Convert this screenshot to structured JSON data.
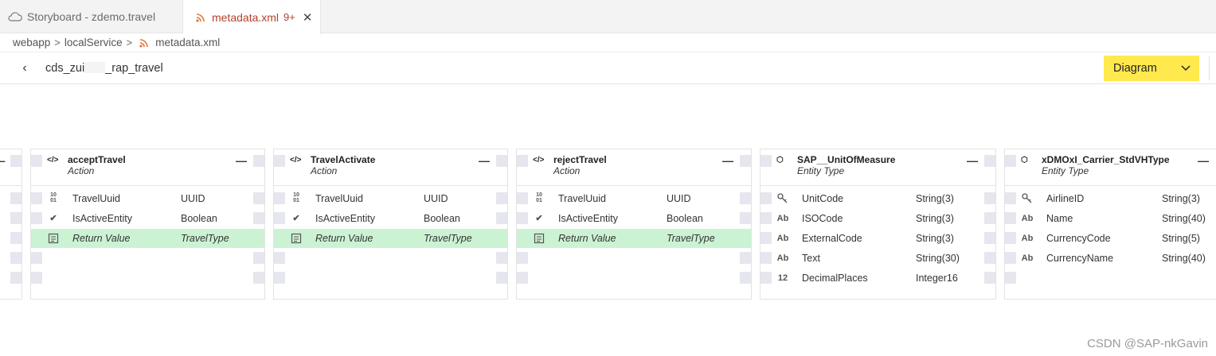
{
  "tabs": [
    {
      "label": "Storyboard - zdemo.travel",
      "icon": "cloud-icon"
    },
    {
      "label": "metadata.xml",
      "badge": "9+",
      "icon": "rss-icon",
      "close": "✕"
    }
  ],
  "breadcrumb": [
    "webapp",
    "localService",
    "metadata.xml"
  ],
  "header": {
    "back": "‹",
    "title_prefix": "cds_zui",
    "title_suffix": "_rap_travel",
    "view_selected": "Diagram"
  },
  "cards": [
    {
      "name": "acceptTravel",
      "type": "Action",
      "icon": "</>",
      "rows": [
        {
          "icon": "10 01",
          "name": "TravelUuid",
          "type": "UUID"
        },
        {
          "icon": "✔",
          "name": "IsActiveEntity",
          "type": "Boolean"
        },
        {
          "icon": "▤",
          "name": "Return Value",
          "type": "TravelType",
          "ret": true
        }
      ]
    },
    {
      "name": "TravelActivate",
      "type": "Action",
      "icon": "</>",
      "rows": [
        {
          "icon": "10 01",
          "name": "TravelUuid",
          "type": "UUID"
        },
        {
          "icon": "✔",
          "name": "IsActiveEntity",
          "type": "Boolean"
        },
        {
          "icon": "▤",
          "name": "Return Value",
          "type": "TravelType",
          "ret": true
        }
      ]
    },
    {
      "name": "rejectTravel",
      "type": "Action",
      "icon": "</>",
      "rows": [
        {
          "icon": "10 01",
          "name": "TravelUuid",
          "type": "UUID"
        },
        {
          "icon": "✔",
          "name": "IsActiveEntity",
          "type": "Boolean"
        },
        {
          "icon": "▤",
          "name": "Return Value",
          "type": "TravelType",
          "ret": true
        }
      ]
    },
    {
      "name": "SAP__UnitOfMeasure",
      "type": "Entity Type",
      "icon": "⬡",
      "rows": [
        {
          "icon": "🔑",
          "name": "UnitCode",
          "type": "String(3)"
        },
        {
          "icon": "Ab",
          "name": "ISOCode",
          "type": "String(3)"
        },
        {
          "icon": "Ab",
          "name": "ExternalCode",
          "type": "String(3)"
        },
        {
          "icon": "Ab",
          "name": "Text",
          "type": "String(30)"
        },
        {
          "icon": "12",
          "name": "DecimalPlaces",
          "type": "Integer16"
        }
      ]
    },
    {
      "name": "xDMOxI_Carrier_StdVHType",
      "type": "Entity Type",
      "icon": "⬡",
      "rows": [
        {
          "icon": "🔑",
          "name": "AirlineID",
          "type": "String(3)"
        },
        {
          "icon": "Ab",
          "name": "Name",
          "type": "String(40)"
        },
        {
          "icon": "Ab",
          "name": "CurrencyCode",
          "type": "String(5)"
        },
        {
          "icon": "Ab",
          "name": "CurrencyName",
          "type": "String(40)"
        }
      ]
    }
  ],
  "watermark": "CSDN @SAP-nkGavin",
  "colors": {
    "accent": "#ffe94d",
    "return_row": "#ccf2d4",
    "tab_active": "#b5412b"
  }
}
